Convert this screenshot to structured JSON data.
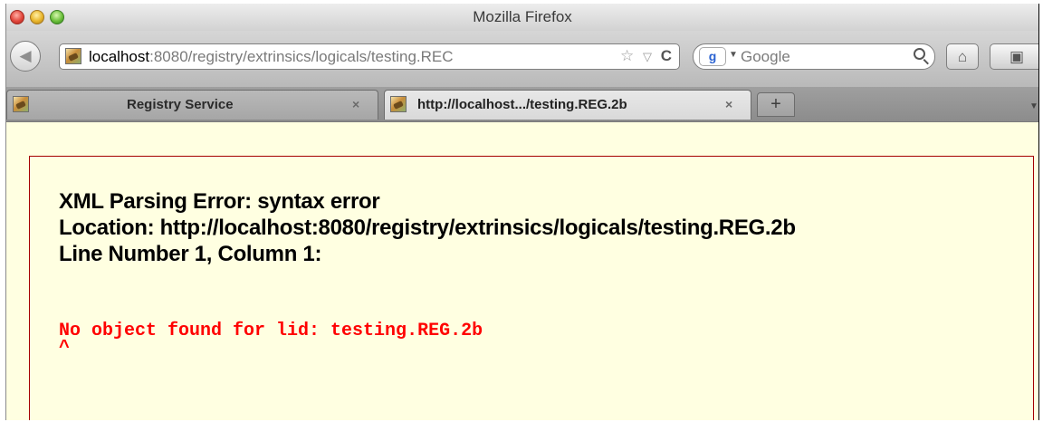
{
  "window": {
    "title": "Mozilla Firefox"
  },
  "nav": {
    "url_host": "localhost",
    "url_rest": ":8080/registry/extrinsics/logicals/testing.REC",
    "star_icon": "☆",
    "dropdown_icon": "▽",
    "reload_icon": "C",
    "search_placeholder": "Google",
    "home_icon": "⌂",
    "bookmarks_icon": "▣"
  },
  "tabs": [
    {
      "title": "Registry Service",
      "close": "×"
    },
    {
      "title": "http://localhost.../testing.REG.2b",
      "close": "×"
    }
  ],
  "new_tab": "+",
  "error": {
    "title": "XML Parsing Error: syntax error",
    "location": "Location: http://localhost:8080/registry/extrinsics/logicals/testing.REG.2b",
    "line": "Line Number 1, Column 1:",
    "source_text": "No object found for lid: testing.REG.2b",
    "caret": "^"
  },
  "colors": {
    "content_bg": "#ffffe1",
    "error_border": "#a50000",
    "error_source": "#ff0000"
  }
}
